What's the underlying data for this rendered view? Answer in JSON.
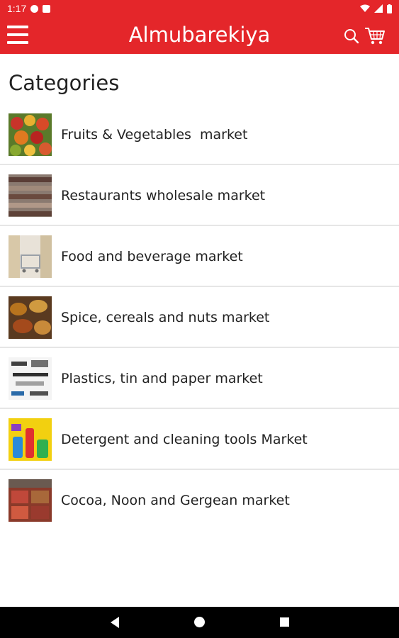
{
  "status_bar": {
    "time": "1:17"
  },
  "app_bar": {
    "title": "Almubarekiya"
  },
  "page": {
    "heading": "Categories"
  },
  "categories": [
    {
      "label": "Fruits & Vegetables  market"
    },
    {
      "label": "Restaurants wholesale market"
    },
    {
      "label": "Food and beverage market"
    },
    {
      "label": "Spice, cereals and nuts market"
    },
    {
      "label": "Plastics, tin and paper market"
    },
    {
      "label": "Detergent and cleaning tools Market"
    },
    {
      "label": "Cocoa, Noon and Gergean market"
    }
  ],
  "colors": {
    "primary": "#e4262a",
    "nav_bar": "#000000"
  },
  "icons": {
    "menu": "hamburger-icon",
    "search": "search-icon",
    "cart": "cart-icon",
    "back": "back-icon",
    "home": "home-icon",
    "recents": "recents-icon"
  }
}
